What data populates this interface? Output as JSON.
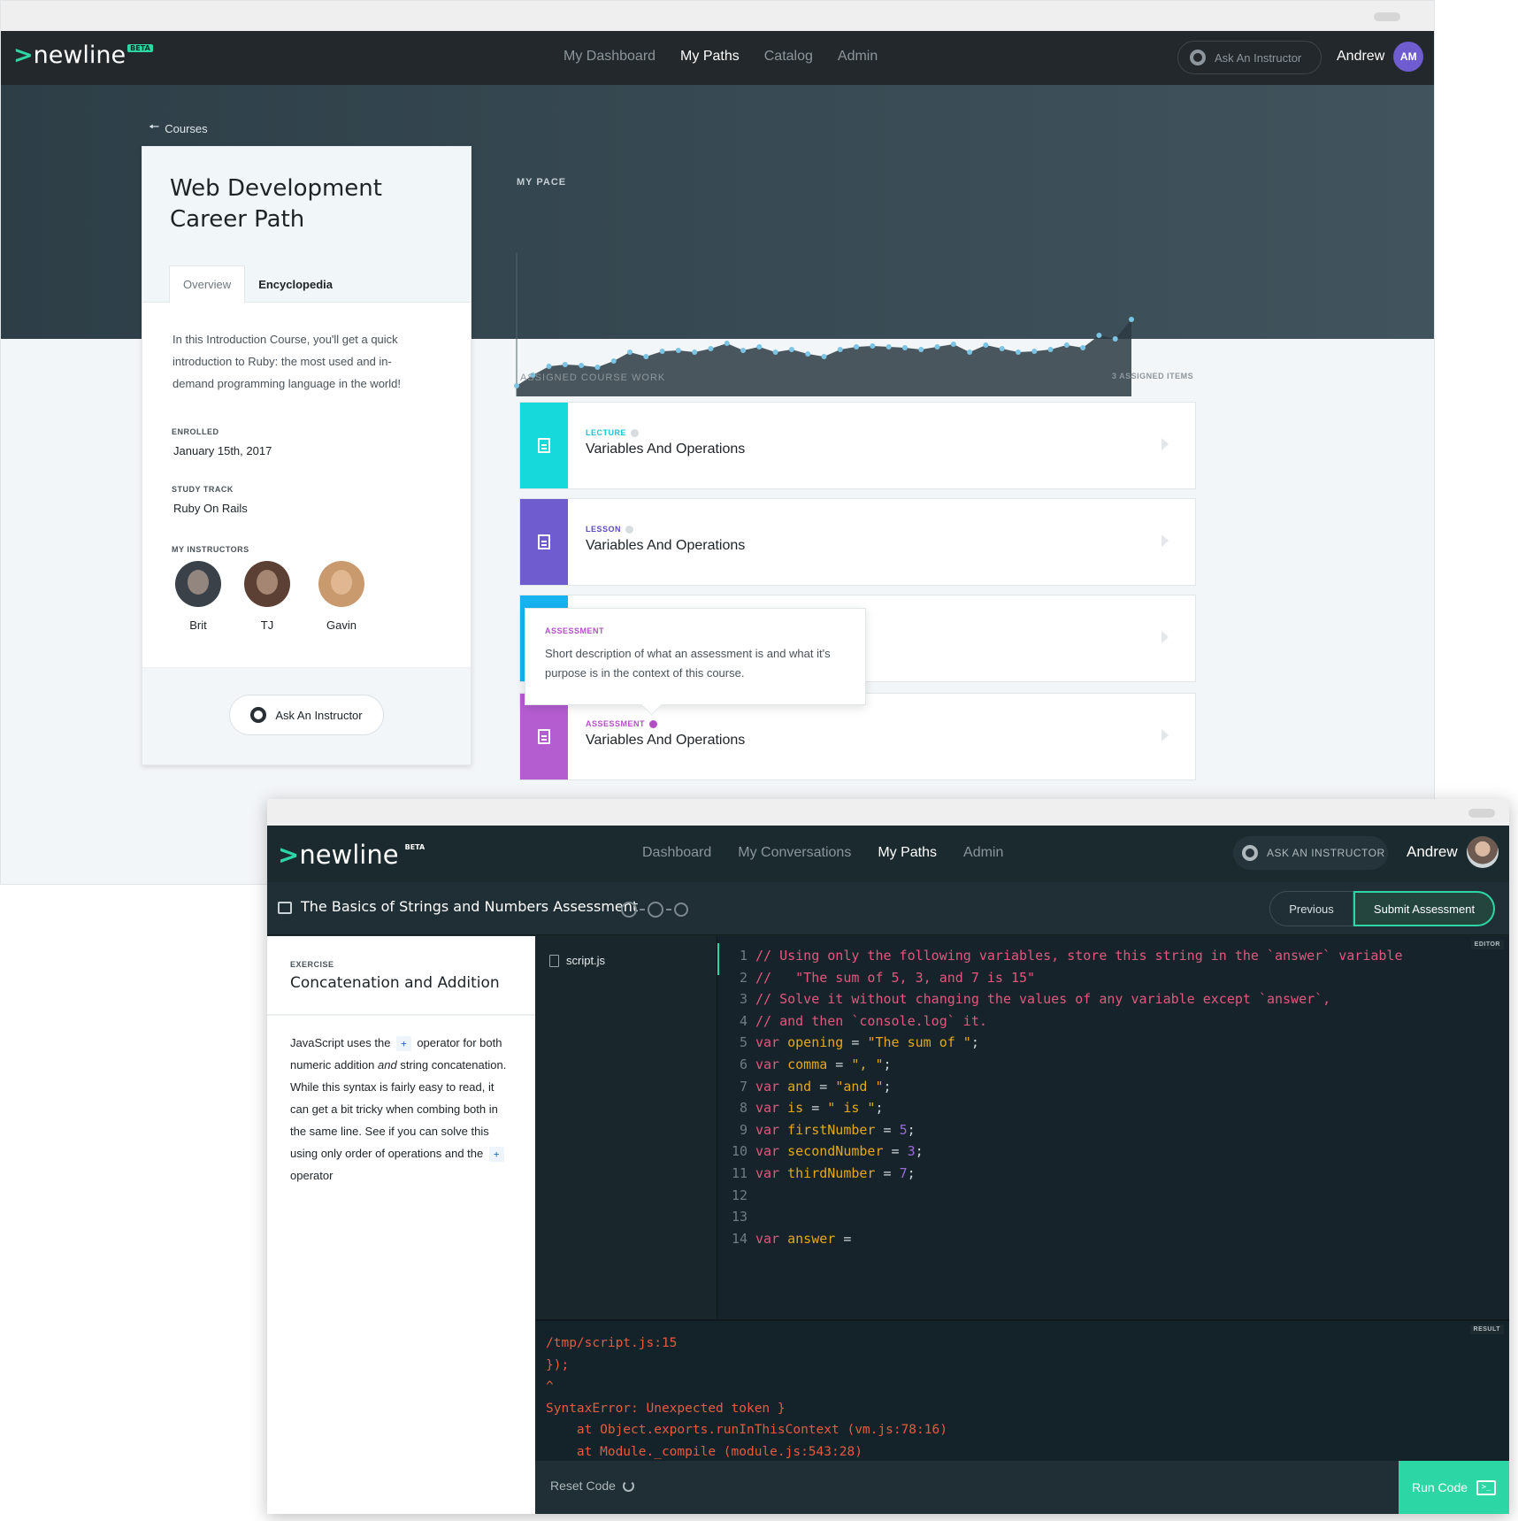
{
  "win1": {
    "nav": {
      "logo_text": "newline",
      "logo_badge": "BETA",
      "links": [
        "My Dashboard",
        "My Paths",
        "Catalog",
        "Admin"
      ],
      "active_link": "My Paths",
      "ask_label": "Ask An Instructor",
      "user_name": "Andrew",
      "user_initials": "AM"
    },
    "back_label": "Courses",
    "pace_label": "MY PACE",
    "pace_points": [
      0.0,
      0.12,
      0.22,
      0.24,
      0.23,
      0.21,
      0.28,
      0.38,
      0.33,
      0.39,
      0.4,
      0.38,
      0.42,
      0.48,
      0.4,
      0.44,
      0.38,
      0.41,
      0.36,
      0.33,
      0.41,
      0.44,
      0.45,
      0.44,
      0.43,
      0.41,
      0.44,
      0.47,
      0.38,
      0.46,
      0.42,
      0.38,
      0.39,
      0.41,
      0.46,
      0.43,
      0.57,
      0.53,
      0.75
    ],
    "course": {
      "title": "Web Development Career Path",
      "tabs": [
        "Overview",
        "Encyclopedia"
      ],
      "description": "In this Introduction Course, you'll get a quick introduction to Ruby: the most used and in-demand programming language in the world!",
      "enrolled_label": "ENROLLED",
      "enrolled_value": "January 15th, 2017",
      "track_label": "STUDY TRACK",
      "track_value": "Ruby On Rails",
      "instructors_label": "MY INSTRUCTORS",
      "instructors": [
        {
          "name": "Brit",
          "color": "#3a4149"
        },
        {
          "name": "TJ",
          "color": "#5b4033"
        },
        {
          "name": "Gavin",
          "color": "#c99a6e"
        }
      ],
      "ask_label": "Ask An Instructor"
    },
    "assigned": {
      "label": "ASSIGNED COURSE WORK",
      "count": "3 ASSIGNED ITEMS",
      "items": [
        {
          "type": "LECTURE",
          "title": "Variables And Operations",
          "color": "#16d9dc",
          "type_color": "#16c7d3"
        },
        {
          "type": "LESSON",
          "title": "Variables And Operations",
          "color": "#6f5ccf",
          "type_color": "#5c49c2"
        },
        {
          "type": "",
          "title": "",
          "color": "#16b3f0",
          "type_color": "#16b3f0"
        },
        {
          "type": "ASSESSMENT",
          "title": "Variables And Operations",
          "color": "#b45dd1",
          "type_color": "#b44ec7"
        }
      ],
      "tooltip_label": "ASSESSMENT",
      "tooltip_text": "Short description of what an assessment is and what it's purpose is in the context of this course."
    }
  },
  "win2": {
    "nav": {
      "logo_text": "newline",
      "logo_badge": "BETA",
      "links": [
        "Dashboard",
        "My Conversations",
        "My Paths",
        "Admin"
      ],
      "active_link": "My Paths",
      "ask_label": "ASK AN INSTRUCTOR",
      "user_name": "Andrew"
    },
    "assessment_title": "The Basics of Strings and Numbers Assessment",
    "previous_label": "Previous",
    "submit_label": "Submit Assessment",
    "exercise": {
      "label": "EXERCISE",
      "title": "Concatenation and Addition",
      "text_1": "JavaScript uses the",
      "op": "+",
      "text_2": "operator for both numeric addition",
      "text_em": "and",
      "text_3": "string concatenation. While this syntax is fairly easy to read, it can get a bit tricky when combing both in the same line. See if you can solve this using only order of operations and the",
      "text_4": "operator"
    },
    "file_name": "script.js",
    "editor_tag": "EDITOR",
    "code_lines": [
      [
        [
          "comment",
          "// Using only the following variables, store this string in the `answer` variable"
        ]
      ],
      [
        [
          "comment",
          "//   \"The sum of 5, 3, and 7 is 15\""
        ]
      ],
      [
        [
          "comment",
          "// Solve it without changing the values of any variable except `answer`,"
        ]
      ],
      [
        [
          "comment",
          "// and then `console.log` it."
        ]
      ],
      [
        [
          "kw",
          "var "
        ],
        [
          "var",
          "opening"
        ],
        [
          "op",
          " = "
        ],
        [
          "str",
          "\"The sum of \""
        ],
        [
          "op",
          ";"
        ]
      ],
      [
        [
          "kw",
          "var "
        ],
        [
          "var",
          "comma"
        ],
        [
          "op",
          " = "
        ],
        [
          "str",
          "\", \""
        ],
        [
          "op",
          ";"
        ]
      ],
      [
        [
          "kw",
          "var "
        ],
        [
          "var",
          "and"
        ],
        [
          "op",
          " = "
        ],
        [
          "str",
          "\"and \""
        ],
        [
          "op",
          ";"
        ]
      ],
      [
        [
          "kw",
          "var "
        ],
        [
          "var",
          "is"
        ],
        [
          "op",
          " = "
        ],
        [
          "str",
          "\" is \""
        ],
        [
          "op",
          ";"
        ]
      ],
      [
        [
          "kw",
          "var "
        ],
        [
          "var",
          "firstNumber"
        ],
        [
          "op",
          " = "
        ],
        [
          "num",
          "5"
        ],
        [
          "op",
          ";"
        ]
      ],
      [
        [
          "kw",
          "var "
        ],
        [
          "var",
          "secondNumber"
        ],
        [
          "op",
          " = "
        ],
        [
          "num",
          "3"
        ],
        [
          "op",
          ";"
        ]
      ],
      [
        [
          "kw",
          "var "
        ],
        [
          "var",
          "thirdNumber"
        ],
        [
          "op",
          " = "
        ],
        [
          "num",
          "7"
        ],
        [
          "op",
          ";"
        ]
      ],
      [],
      [],
      [
        [
          "kw",
          "var "
        ],
        [
          "var",
          "answer"
        ],
        [
          "op",
          " ="
        ]
      ]
    ],
    "result_tag": "RESULT",
    "result_lines": [
      "/tmp/script.js:15",
      "});",
      "^",
      "SyntaxError: Unexpected token }",
      "    at Object.exports.runInThisContext (vm.js:78:16)",
      "    at Module._compile (module.js:543:28)"
    ],
    "reset_label": "Reset Code",
    "run_label": "Run Code",
    "run_icon": ">_"
  }
}
